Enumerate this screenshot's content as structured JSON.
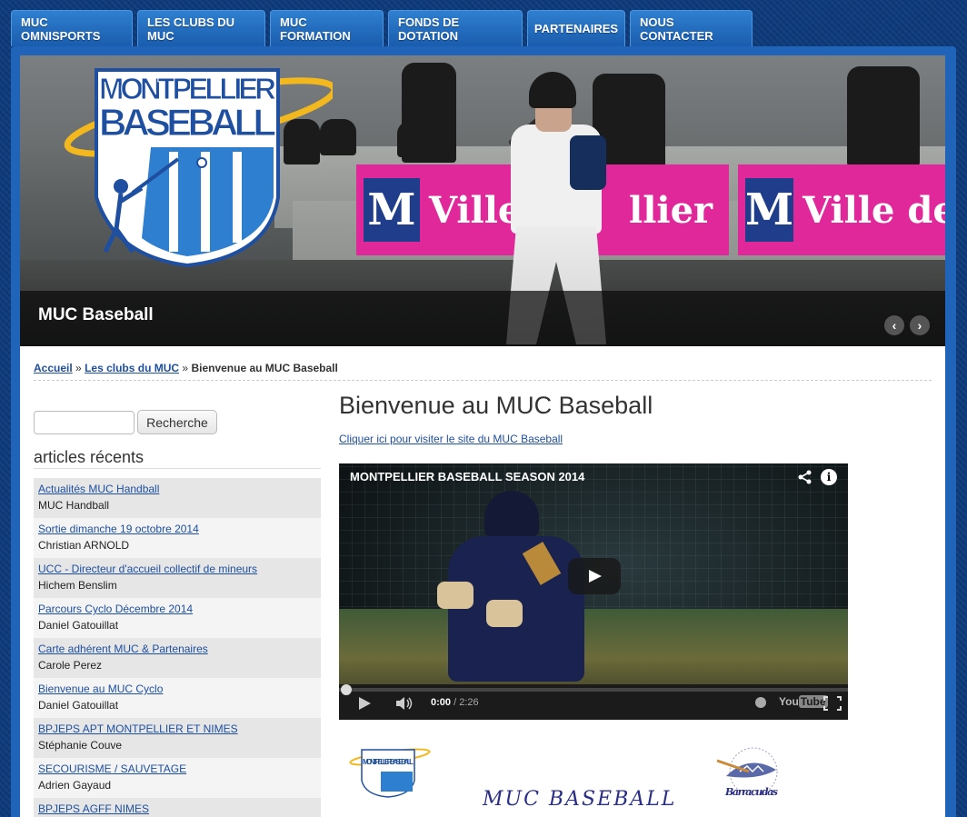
{
  "nav": {
    "tabs": [
      "MUC OMNISPORTS",
      "LES CLUBS DU MUC",
      "MUC FORMATION",
      "FONDS DE DOTATION",
      "PARTENAIRES",
      "NOUS CONTACTER"
    ]
  },
  "banner": {
    "logo_line1": "MONTPELLIER",
    "logo_line2": "BASEBALL",
    "caption": "MUC Baseball",
    "ad_text1": "Ville d",
    "ad_text2": "llier",
    "ad_text3": "Ville de M",
    "ad_mark": "M",
    "ad_sub": "Montpellier",
    "prev_label": "‹",
    "next_label": "›"
  },
  "breadcrumb": {
    "home": "Accueil",
    "sep": "»",
    "clubs": "Les clubs du MUC",
    "current": "Bienvenue au MUC Baseball"
  },
  "search": {
    "value": "",
    "button": "Recherche"
  },
  "sidebar": {
    "title": "articles récents",
    "items": [
      {
        "title": "Actualités MUC Handball",
        "author": "MUC Handball"
      },
      {
        "title": "Sortie dimanche 19 octobre 2014",
        "author": "Christian ARNOLD"
      },
      {
        "title": "UCC - Directeur d'accueil collectif de mineurs",
        "author": "Hichem Benslim"
      },
      {
        "title": "Parcours Cyclo Décembre 2014",
        "author": "Daniel Gatouillat"
      },
      {
        "title": "Carte adhérent MUC & Partenaires",
        "author": "Carole Perez"
      },
      {
        "title": "Bienvenue au MUC Cyclo",
        "author": "Daniel Gatouillat"
      },
      {
        "title": "BPJEPS APT MONTPELLIER ET NIMES",
        "author": "Stéphanie Couve"
      },
      {
        "title": "SECOURISME / SAUVETAGE",
        "author": "Adrien Gayaud"
      },
      {
        "title": "BPJEPS AGFF NIMES",
        "author": ""
      }
    ]
  },
  "main": {
    "title": "Bienvenue au MUC Baseball",
    "visit_link": "Cliquer ici pour visiter le site du MUC Baseball",
    "video": {
      "title": "MONTPELLIER BASEBALL SEASON 2014",
      "current_time": "0:00",
      "duration": "/ 2:26",
      "progress": 0,
      "yt_you": "You",
      "yt_tube": "Tube",
      "info_glyph": "i"
    },
    "bottom_text": "MUC BASEBALL",
    "bottom_logo_left": "MONTPELLIER BASEBALL",
    "bottom_logo_right": "Barracudas"
  },
  "colors": {
    "nav_tab": "#1a5cad",
    "link": "#1e4fa0",
    "ad_pink": "#e0289a",
    "ad_blue": "#1f3d8b",
    "logo_gold": "#f2b81e"
  }
}
